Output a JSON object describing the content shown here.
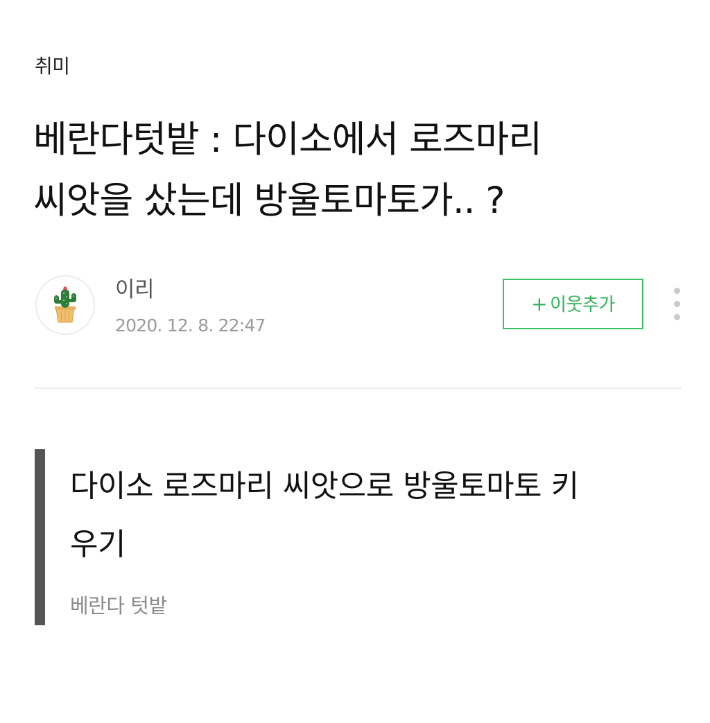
{
  "category": "취미",
  "title": {
    "lines": [
      "베란다텃밭 : 다이소에서 로즈마리",
      "씨앗을 샀는데 방울토마토가.. ?"
    ]
  },
  "author": {
    "name": "이리",
    "date": "2020. 12. 8. 22:47",
    "avatar_icon": "cactus-icon"
  },
  "actions": {
    "add_neighbor_plus": "+",
    "add_neighbor_label": "이웃추가",
    "more_icon": "more-vertical-icon"
  },
  "quote": {
    "lines": [
      "다이소 로즈마리 씨앗으로 방울토마토 키",
      "우기"
    ],
    "source": "베란다 텃밭"
  },
  "colors": {
    "accent_green": "#3dc064",
    "quote_bar": "#555555",
    "meta_gray": "#9a9a9a"
  }
}
